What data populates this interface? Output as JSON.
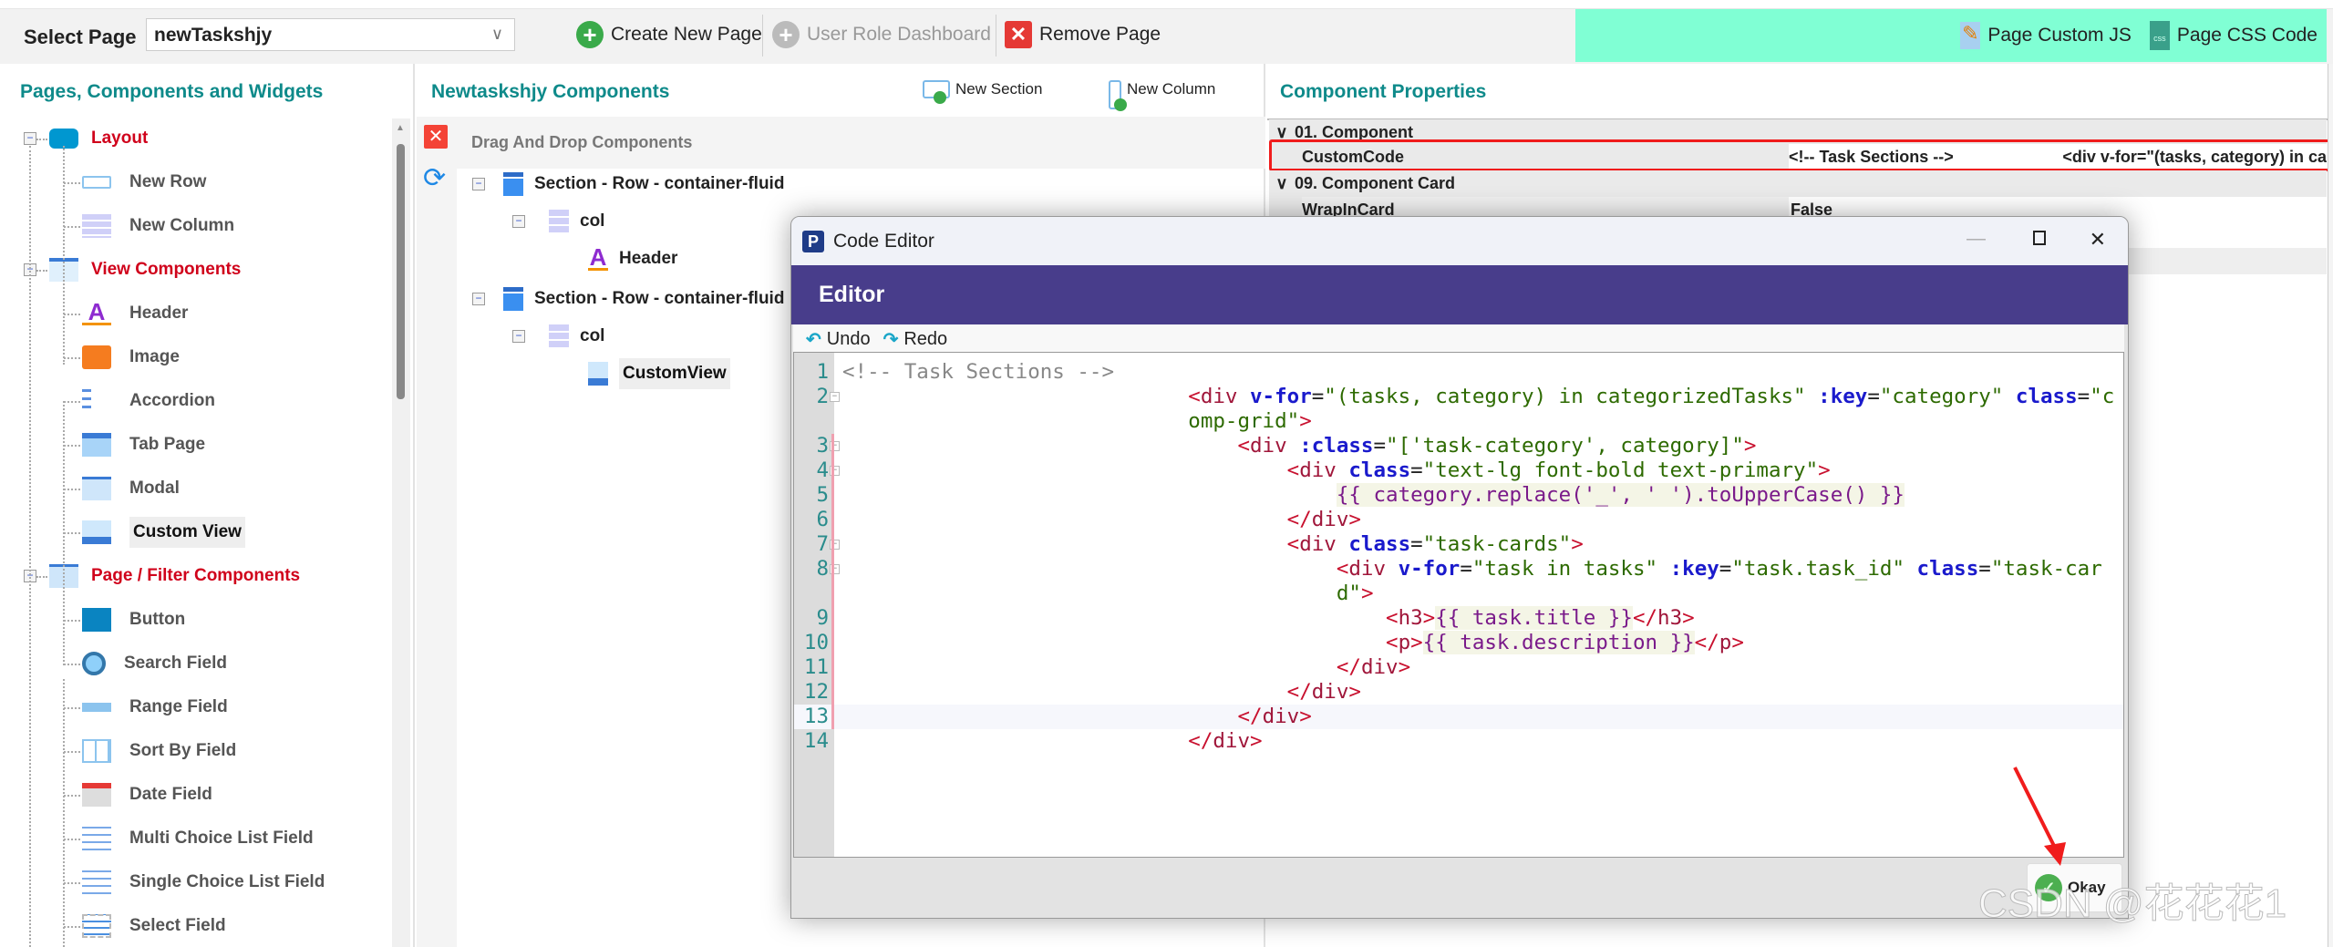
{
  "toolbar": {
    "select_label": "Select Page",
    "selected_page": "newTaskshjy",
    "create_new_page": "Create New Page",
    "user_role_dashboard": "User Role Dashboard",
    "remove_page": "Remove Page",
    "page_custom_js": "Page Custom JS",
    "page_css_code": "Page CSS Code",
    "accent_color": "#80ffd4"
  },
  "left_panel": {
    "title": "Pages, Components and Widgets",
    "items": [
      {
        "label": "Layout",
        "type": "category",
        "icon": "layout-icon"
      },
      {
        "label": "New Row",
        "type": "item",
        "icon": "new-row-icon"
      },
      {
        "label": "New Column",
        "type": "item",
        "icon": "new-column-icon"
      },
      {
        "label": "View Components",
        "type": "category",
        "icon": "view-components-icon"
      },
      {
        "label": "Header",
        "type": "item",
        "icon": "header-icon"
      },
      {
        "label": "Image",
        "type": "item",
        "icon": "image-icon"
      },
      {
        "label": "Accordion",
        "type": "item",
        "icon": "accordion-icon"
      },
      {
        "label": "Tab Page",
        "type": "item",
        "icon": "tab-page-icon"
      },
      {
        "label": "Modal",
        "type": "item",
        "icon": "modal-icon"
      },
      {
        "label": "Custom View",
        "type": "item",
        "icon": "custom-view-icon",
        "selected": true
      },
      {
        "label": "Page / Filter Components",
        "type": "category",
        "icon": "page-filter-icon"
      },
      {
        "label": "Button",
        "type": "item",
        "icon": "button-icon"
      },
      {
        "label": "Search Field",
        "type": "item",
        "icon": "search-icon"
      },
      {
        "label": "Range Field",
        "type": "item",
        "icon": "range-icon"
      },
      {
        "label": "Sort By Field",
        "type": "item",
        "icon": "sort-icon"
      },
      {
        "label": "Date Field",
        "type": "item",
        "icon": "calendar-icon"
      },
      {
        "label": "Multi Choice List Field",
        "type": "item",
        "icon": "multi-choice-icon"
      },
      {
        "label": "Single Choice List Field",
        "type": "item",
        "icon": "single-choice-icon"
      },
      {
        "label": "Select Field",
        "type": "item",
        "icon": "select-icon"
      }
    ]
  },
  "middle_panel": {
    "title": "Newtaskshjy Components",
    "new_section": "New Section",
    "new_column": "New Column",
    "dnd_label": "Drag And Drop Components",
    "tree": [
      {
        "label": "Section - Row - container-fluid",
        "level": 0,
        "icon": "section-icon"
      },
      {
        "label": "col",
        "level": 1,
        "icon": "column-icon"
      },
      {
        "label": "Header",
        "level": 2,
        "icon": "header-icon"
      },
      {
        "label": "Section - Row - container-fluid",
        "level": 0,
        "icon": "section-icon"
      },
      {
        "label": "col",
        "level": 1,
        "icon": "column-icon"
      },
      {
        "label": "CustomView",
        "level": 2,
        "icon": "custom-view-icon",
        "selected": true
      }
    ]
  },
  "right_panel": {
    "title": "Component Properties",
    "groups": [
      {
        "label": "01. Component",
        "rows": [
          {
            "name": "CustomCode",
            "value": "<!-- Task Sections -->",
            "value2": "<div v-for=\"(tasks, category) in ca",
            "highlighted": true
          }
        ]
      },
      {
        "label": "09. Component Card",
        "rows": [
          {
            "name": "WrapInCard",
            "value": "False"
          }
        ]
      }
    ]
  },
  "modal": {
    "window_title": "Code Editor",
    "header": "Editor",
    "undo": "Undo",
    "redo": "Redo",
    "okay": "Okay",
    "header_color": "#483d8b",
    "code_lines": [
      "<!-- Task Sections -->",
      "                            <div v-for=\"(tasks, category) in categorizedTasks\" :key=\"category\" class=\"comp-grid\">",
      "                                <div :class=\"['task-category', category]\">",
      "                                    <div class=\"text-lg font-bold text-primary\">",
      "                                        {{ category.replace('_', ' ').toUpperCase() }}",
      "                                    </div>",
      "                                    <div class=\"task-cards\">",
      "                                        <div v-for=\"task in tasks\" :key=\"task.task_id\" class=\"task-card\">",
      "                                            <h3>{{ task.title }}</h3>",
      "                                            <p>{{ task.description }}</p>",
      "                                        </div>",
      "                                    </div>",
      "                                </div>",
      "                            </div>"
    ],
    "folded_lines": [
      2,
      3,
      4,
      7,
      8
    ],
    "changed_lines": [
      3,
      4,
      5,
      6,
      7,
      8,
      9,
      10,
      11,
      12,
      13
    ],
    "current_line": 13
  },
  "watermark": "CSDN @花花花1"
}
